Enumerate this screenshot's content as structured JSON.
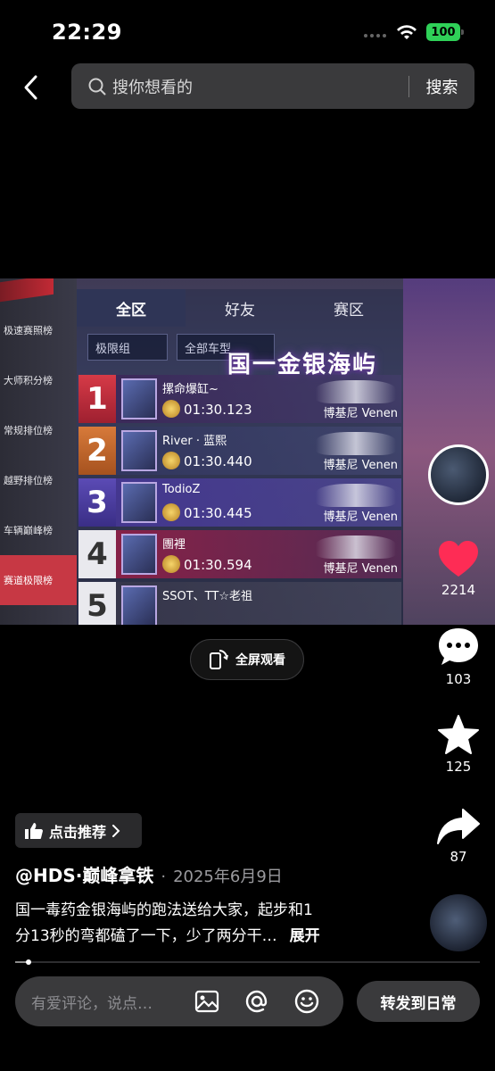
{
  "status_bar": {
    "time": "22:29",
    "battery": "100"
  },
  "search": {
    "placeholder": "搜你想看的",
    "button_label": "搜索"
  },
  "video": {
    "side_menu": [
      "极速赛照榜",
      "大师积分榜",
      "常规排位榜",
      "越野排位榜",
      "车辆巅峰榜",
      "赛道极限榜"
    ],
    "tabs": [
      "全区",
      "好友",
      "赛区"
    ],
    "filters": [
      "极限组",
      "全部车型"
    ],
    "title": "国一金银海屿",
    "rows": [
      {
        "rank": "1",
        "name": "摞命爆缸~",
        "time": "01:30.123",
        "car": "博基尼 Venen"
      },
      {
        "rank": "2",
        "name": "River · 蓝熙",
        "time": "01:30.440",
        "car": "博基尼 Venen"
      },
      {
        "rank": "3",
        "name": "TodioZ",
        "time": "01:30.445",
        "car": "博基尼 Venen"
      },
      {
        "rank": "4",
        "name": "團裡",
        "time": "01:30.594",
        "car": "博基尼 Venen"
      },
      {
        "rank": "5",
        "name": "SSOT、TT☆老祖",
        "time": "",
        "car": ""
      }
    ]
  },
  "fullscreen_label": "全屏观看",
  "actions": {
    "likes": "2214",
    "comments": "103",
    "favorites": "125",
    "shares": "87"
  },
  "colors": {
    "like_red": "#fe2c55",
    "battery_green": "#2fd158"
  },
  "recommend_label": "点击推荐",
  "post": {
    "author": "@HDS·巅峰拿铁",
    "separator": "·",
    "date": "2025年6月9日",
    "caption_line1": "国一毒药金银海屿的跑法送给大家，起步和1",
    "caption_line2": "分13秒的弯都磕了一下，少了两分干…",
    "expand": "展开"
  },
  "progress": 0.03,
  "comment": {
    "placeholder": "有爱评论，说点…"
  },
  "share_daily_label": "转发到日常"
}
